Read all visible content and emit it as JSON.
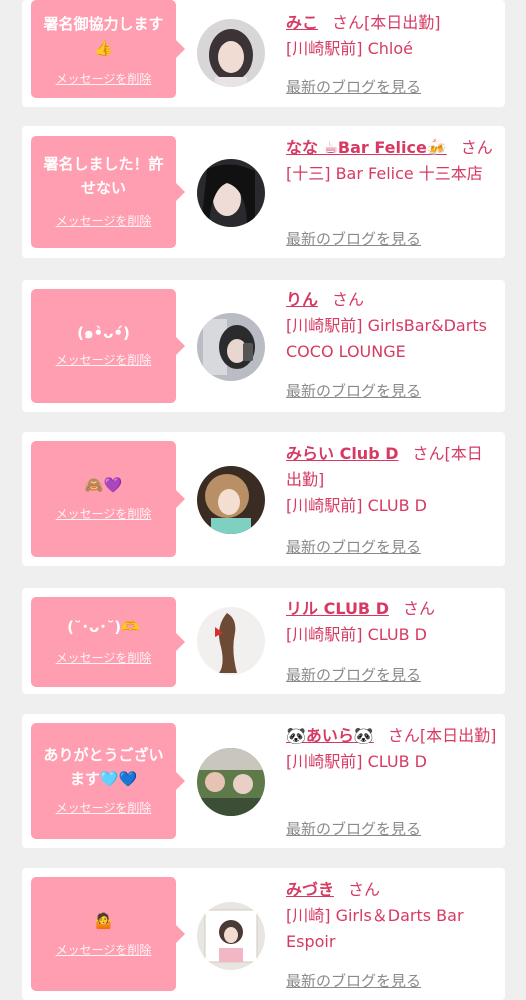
{
  "delete_label": "メッセージを削除",
  "blog_label": "最新のブログを見る",
  "honorific": "さん",
  "colors": {
    "bubble": "#ff9db1",
    "accent": "#d63a63",
    "link_gray": "#8a8a8a",
    "background": "#efefef"
  },
  "cards": [
    {
      "message": "署名御協力します👍",
      "name": "みこ",
      "status": "[本日出勤]",
      "shop": "[川崎駅前] Chloé"
    },
    {
      "message": "署名しました！許せない",
      "name": "なな ☕Bar Felice🍻",
      "status": "",
      "shop": "[十三] Bar Felice 十三本店"
    },
    {
      "message": "(๑•̀ᴗ•́)",
      "name": "りん",
      "status": "",
      "shop": "[川崎駅前] GirlsBar&Darts COCO LOUNGE"
    },
    {
      "message": "🙈💜",
      "name": "みらい Club D",
      "status": "[本日出勤]",
      "shop": "[川崎駅前] CLUB D"
    },
    {
      "message": "(˘･ᴗ･˘)🫶",
      "name": "リル CLUB D",
      "status": "",
      "shop": "[川崎駅前] CLUB D"
    },
    {
      "message": "ありがとうございます🩵💙",
      "name": "🐼あいら🐼",
      "status": "[本日出勤]",
      "shop": "[川崎駅前] CLUB D"
    },
    {
      "message": "🤷",
      "name": "みづき",
      "status": "",
      "shop": "[川崎] Girls＆Darts Bar Espoir"
    }
  ]
}
